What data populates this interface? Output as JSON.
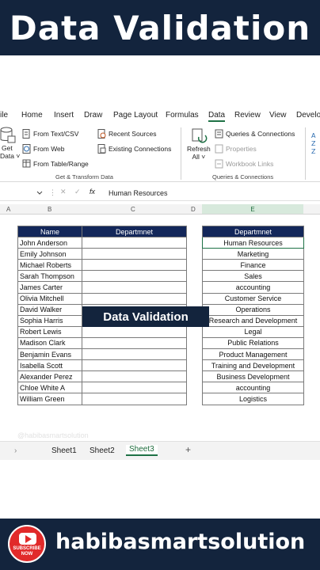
{
  "banner_title": "Data Validation",
  "ribbon_tabs": [
    "ile",
    "Home",
    "Insert",
    "Draw",
    "Page Layout",
    "Formulas",
    "Data",
    "Review",
    "View",
    "Develo"
  ],
  "active_tab": "Data",
  "ribbon": {
    "get_data": "Get",
    "get_data_sub": "Data ˅",
    "from_text_csv": "From Text/CSV",
    "from_web": "From Web",
    "from_table_range": "From Table/Range",
    "recent_sources": "Recent Sources",
    "existing_connections": "Existing Connections",
    "group_get_transform": "Get & Transform Data",
    "refresh": "Refresh",
    "refresh_all": "All ˅",
    "queries_connections": "Queries & Connections",
    "properties": "Properties",
    "workbook_links": "Workbook Links",
    "group_queries": "Queries & Connections"
  },
  "formula_bar": {
    "fx": "fx",
    "value": "Human Resources"
  },
  "columns": [
    "A",
    "B",
    "C",
    "D",
    "E"
  ],
  "table1": {
    "headers": [
      "Name",
      "Departmnet"
    ],
    "names": [
      "John Anderson",
      "Emily Johnson",
      "Michael Roberts",
      "Sarah Thompson",
      "James Carter",
      "Olivia Mitchell",
      "David Walker",
      "Sophia Harris",
      "Robert Lewis",
      "Madison Clark",
      "Benjamin Evans",
      "Isabella Scott",
      "Alexander Perez",
      "Chloe White  A",
      "William Green"
    ]
  },
  "table2": {
    "header": "Departmnet",
    "items": [
      "Human Resources",
      "Marketing",
      "Finance",
      "Sales",
      "accounting",
      "Customer Service",
      "Operations",
      "Research and Development",
      "Legal",
      "Public Relations",
      "Product Management",
      "Training and Development",
      "Business Development",
      "accounting",
      "Logistics"
    ]
  },
  "overlay_label": "Data Validation",
  "watermark": "@habibasmartsolution",
  "sheets": [
    "Sheet1",
    "Sheet2",
    "Sheet3"
  ],
  "active_sheet": "Sheet3",
  "add_sheet": "+",
  "brand": "habibasmartsolution",
  "subscribe_line1": "SUBSCRIBE",
  "subscribe_line2": "NOW",
  "colors": {
    "banner": "#13243d",
    "table_header": "#13275a",
    "excel_green": "#1e7145"
  }
}
